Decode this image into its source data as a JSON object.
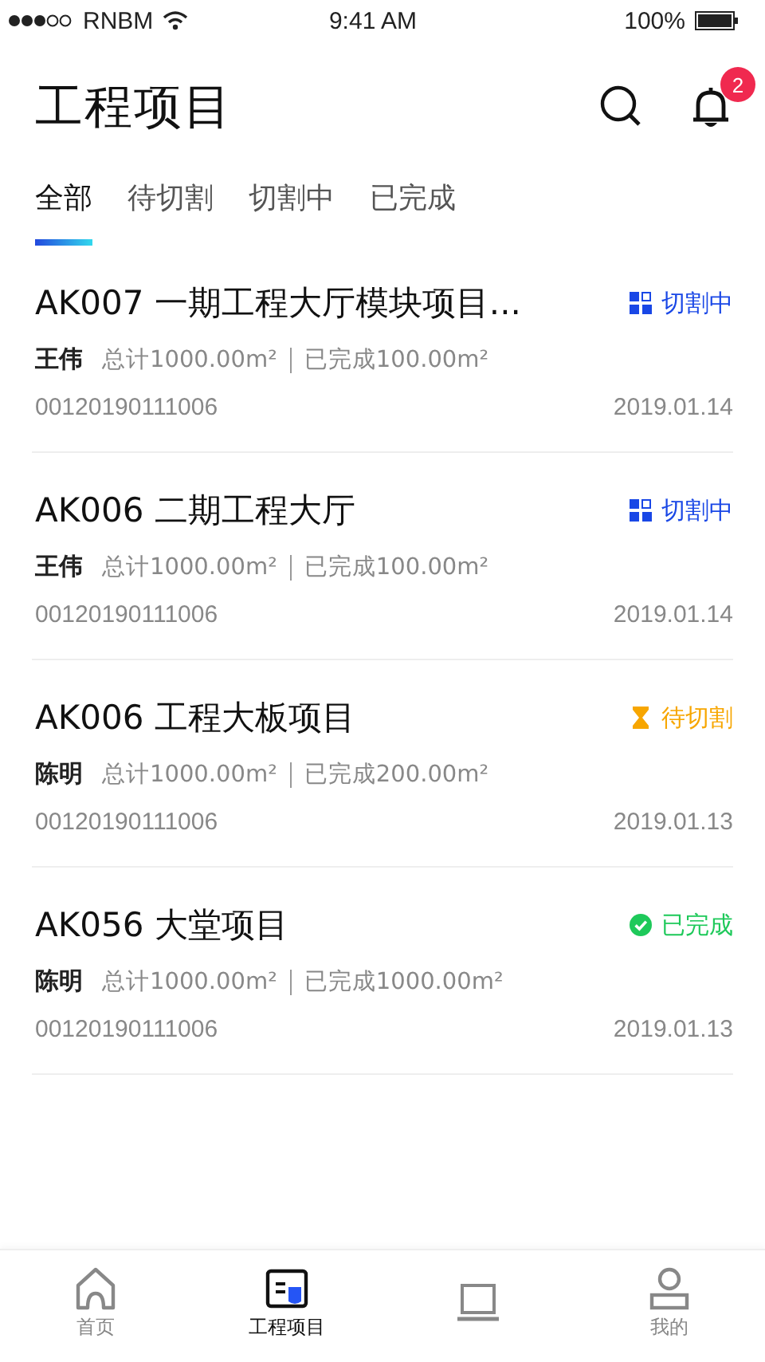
{
  "status_bar": {
    "carrier": "RNBM",
    "time": "9:41 AM",
    "battery": "100%"
  },
  "header": {
    "title": "工程项目",
    "notification_count": "2"
  },
  "tabs": [
    {
      "label": "全部",
      "selected": true
    },
    {
      "label": "待切割",
      "selected": false
    },
    {
      "label": "切割中",
      "selected": false
    },
    {
      "label": "已完成",
      "selected": false
    }
  ],
  "projects": [
    {
      "title": "AK007 一期工程大厅模块项目...",
      "status": {
        "kind": "cutting",
        "label": "切割中",
        "color": "#1947e6"
      },
      "owner": "王伟",
      "total": "总计1000.00m²",
      "completed": "已完成100.00m²",
      "code": "00120190111006",
      "date": "2019.01.14"
    },
    {
      "title": "AK006 二期工程大厅",
      "status": {
        "kind": "cutting",
        "label": "切割中",
        "color": "#1947e6"
      },
      "owner": "王伟",
      "total": "总计1000.00m²",
      "completed": "已完成100.00m²",
      "code": "00120190111006",
      "date": "2019.01.14"
    },
    {
      "title": "AK006 工程大板项目",
      "status": {
        "kind": "pending",
        "label": "待切割",
        "color": "#f7a600"
      },
      "owner": "陈明",
      "total": "总计1000.00m²",
      "completed": "已完成200.00m²",
      "code": "00120190111006",
      "date": "2019.01.13"
    },
    {
      "title": "AK056 大堂项目",
      "status": {
        "kind": "done",
        "label": "已完成",
        "color": "#1ec95a"
      },
      "owner": "陈明",
      "total": "总计1000.00m²",
      "completed": "已完成1000.00m²",
      "code": "00120190111006",
      "date": "2019.01.13"
    }
  ],
  "bottom_nav": [
    {
      "kind": "home",
      "label": "首页",
      "selected": false
    },
    {
      "kind": "projects",
      "label": "工程项目",
      "selected": true
    },
    {
      "kind": "laptop",
      "selected": false
    },
    {
      "kind": "profile",
      "label": "我的",
      "selected": false
    }
  ]
}
